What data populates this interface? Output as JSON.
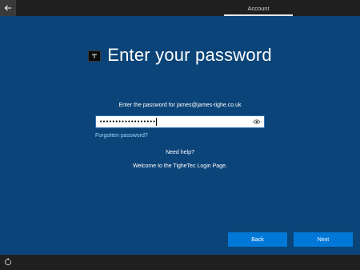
{
  "header": {
    "back_icon": "arrow-left-icon",
    "tab_label": "Account"
  },
  "main": {
    "title": "Enter your password",
    "title_icon": "tighetec-logo-icon",
    "prompt": "Enter the password for james@james-tighe.co.uk",
    "password_field": {
      "value": "••••••••••••••••••",
      "reveal_icon": "eye-icon"
    },
    "forgot_label": "Forgotten password?",
    "need_help": "Need help?",
    "welcome": "Welcome to the TigheTec Login Page."
  },
  "footer": {
    "back_label": "Back",
    "next_label": "Next",
    "accessibility_icon": "ease-of-access-icon"
  },
  "colors": {
    "background": "#0b4478",
    "bar": "#1f1f1f",
    "button": "#0078d7",
    "link": "#9fd2ff"
  }
}
